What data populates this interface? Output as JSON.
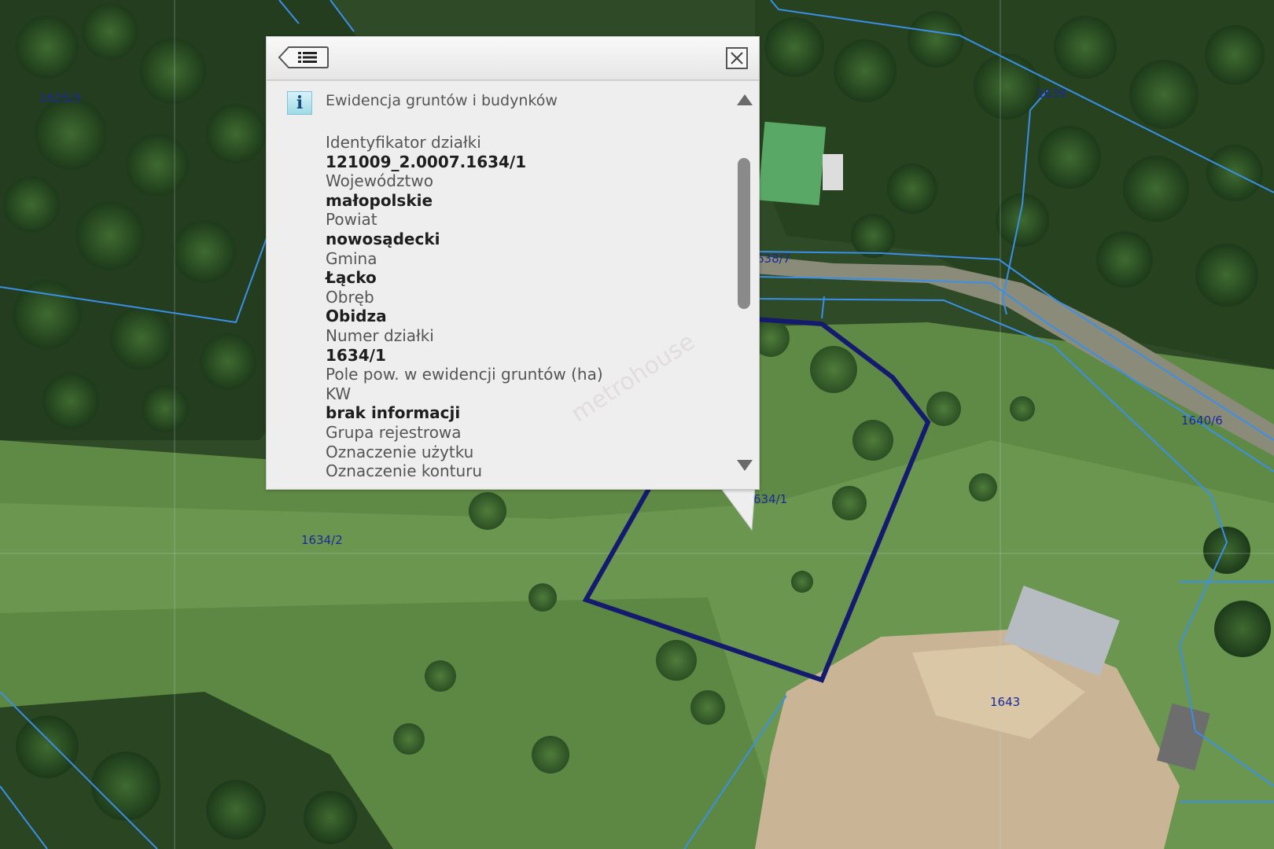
{
  "map": {
    "parcel_labels": [
      "1625/3",
      "1639",
      "638/7",
      "1640/6",
      "634/1",
      "1634/2",
      "1643"
    ],
    "colors": {
      "parcel_boundary": "#3a8fe8",
      "selected_parcel": "#141a6e",
      "label": "#1a2a9a"
    }
  },
  "popup": {
    "back_icon": "list-back-icon",
    "close_icon": "close-icon",
    "info_icon_glyph": "i",
    "source_title": "Ewidencja gruntów i budynków",
    "fields": [
      {
        "label": "Identyfikator działki",
        "value": "121009_2.0007.1634/1"
      },
      {
        "label": "Województwo",
        "value": "małopolskie"
      },
      {
        "label": "Powiat",
        "value": "nowosądecki"
      },
      {
        "label": "Gmina",
        "value": "Łącko"
      },
      {
        "label": "Obręb",
        "value": "Obidza"
      },
      {
        "label": "Numer działki",
        "value": "1634/1"
      },
      {
        "label": "Pole pow. w ewidencji gruntów (ha)",
        "value": ""
      },
      {
        "label": "KW",
        "value": "brak informacji"
      },
      {
        "label": "Grupa rejestrowa",
        "value": ""
      },
      {
        "label": "Oznaczenie użytku",
        "value": ""
      },
      {
        "label": "Oznaczenie konturu",
        "value": ""
      }
    ]
  },
  "watermark": "metrohouse"
}
